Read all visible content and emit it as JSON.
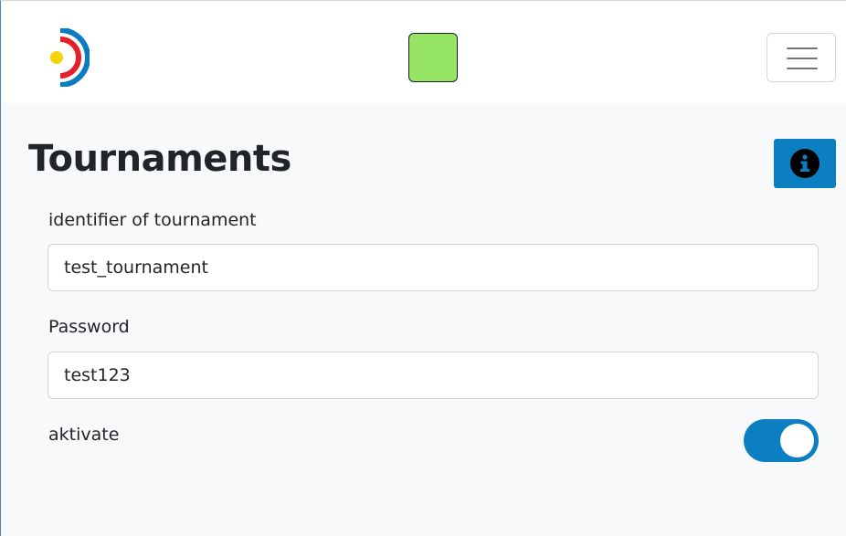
{
  "colors": {
    "primary": "#0b7fc1",
    "status_indicator": "#95e464",
    "text": "#212529"
  },
  "header": {
    "logo_icon": "target-logo-icon",
    "status_icon": "status-square",
    "menu_icon": "hamburger-menu-icon"
  },
  "page": {
    "title": "Tournaments",
    "info_icon": "info-circle-icon"
  },
  "form": {
    "identifier_label": "identifier of tournament",
    "identifier_value": "test_tournament",
    "password_label": "Password",
    "password_value": "test123",
    "activate_label": "aktivate",
    "activate_checked": true
  }
}
